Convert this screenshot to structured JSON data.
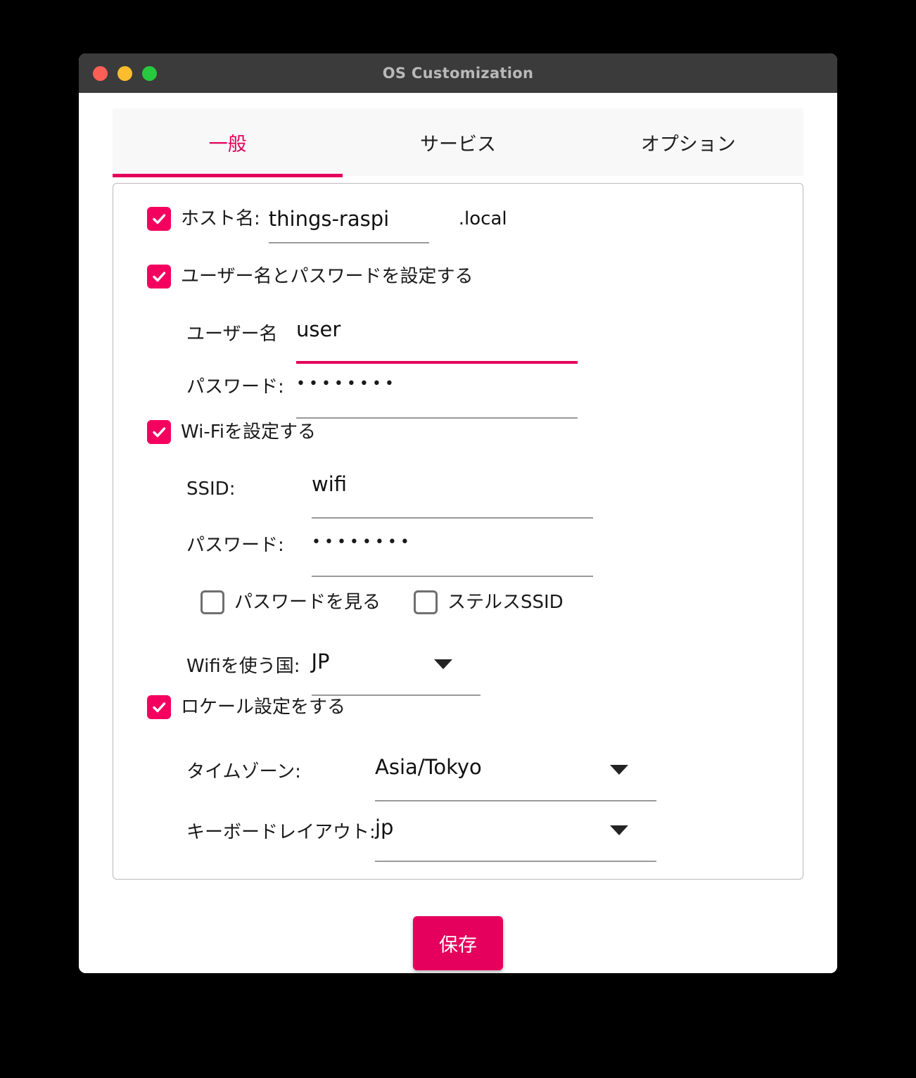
{
  "window": {
    "title": "OS Customization",
    "traffic_lights": [
      {
        "name": "close",
        "color": "#fd5f56"
      },
      {
        "name": "minimize",
        "color": "#fdbc2e"
      },
      {
        "name": "zoom",
        "color": "#27c93f"
      }
    ]
  },
  "theme": {
    "accent": "#e4005c",
    "checkbox_fill": "#f4005f",
    "titlebar_bg": "#3b3b3b",
    "tabbar_bg": "#f8f8f8",
    "underline": "#9a9a9a"
  },
  "tabs": [
    {
      "label": "一般",
      "active": true
    },
    {
      "label": "サービス",
      "active": false
    },
    {
      "label": "オプション",
      "active": false
    }
  ],
  "form": {
    "hostname": {
      "checkbox_checked": true,
      "label": "ホスト名:",
      "value": "things-raspi",
      "suffix": ".local"
    },
    "set_user": {
      "checkbox_checked": true,
      "label": "ユーザー名とパスワードを設定する"
    },
    "username": {
      "label": "ユーザー名",
      "value": "user",
      "focused": true
    },
    "user_password": {
      "label": "パスワード:",
      "value": "••••••••"
    },
    "set_wifi": {
      "checkbox_checked": true,
      "label": "Wi-Fiを設定する"
    },
    "ssid": {
      "label": "SSID:",
      "value": "wifi"
    },
    "wifi_password": {
      "label": "パスワード:",
      "value": "••••••••"
    },
    "show_password": {
      "checkbox_checked": false,
      "label": "パスワードを見る"
    },
    "hidden_ssid": {
      "checkbox_checked": false,
      "label": "ステルスSSID"
    },
    "wifi_country": {
      "label": "Wifiを使う国:",
      "value": "JP"
    },
    "set_locale": {
      "checkbox_checked": true,
      "label": "ロケール設定をする"
    },
    "timezone": {
      "label": "タイムゾーン:",
      "value": "Asia/Tokyo"
    },
    "keyboard": {
      "label": "キーボードレイアウト:",
      "value": "jp"
    }
  },
  "actions": {
    "save_label": "保存"
  }
}
